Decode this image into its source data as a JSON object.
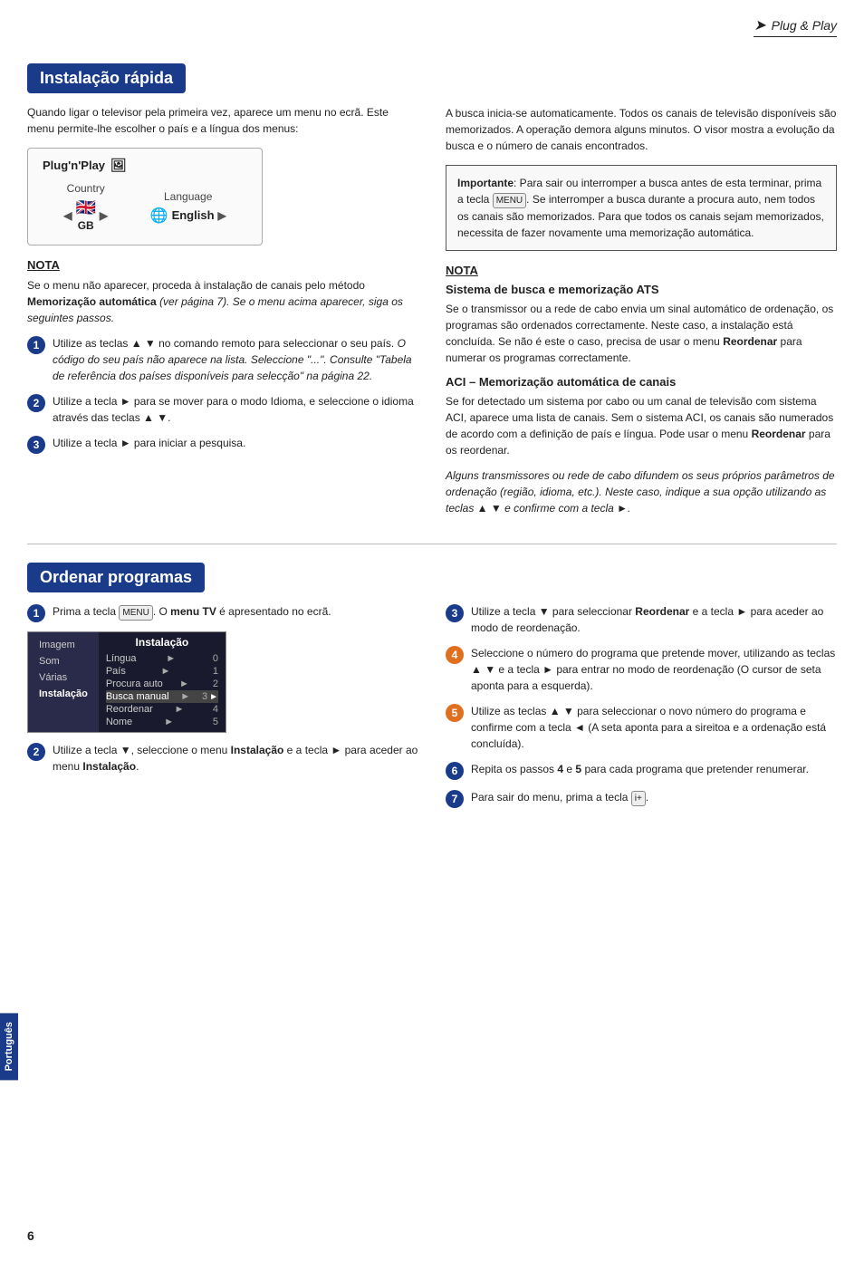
{
  "header": {
    "plug_play": "Plug & Play"
  },
  "section1": {
    "title": "Instalação rápida",
    "left": {
      "intro": "Quando ligar o televisor pela primeira vez, aparece um menu no ecrã. Este menu permite-lhe escolher o país e a língua dos menus:",
      "plugnplay_box": {
        "title": "Plug'n'Play",
        "country_label": "Country",
        "country_value": "GB",
        "language_label": "Language",
        "language_value": "English"
      },
      "nota_title": "NOTA",
      "nota_body": "Se o menu não aparecer, proceda à instalação de canais pelo método Memorização automática (ver página 7). Se o menu acima aparecer, siga os seguintes passos.",
      "steps": [
        {
          "num": "1",
          "text": "Utilize as teclas ▲ ▼ no comando remoto para seleccionar o seu país. O código do seu país não aparece na lista. Seleccione \"...\". Consulte \"Tabela de referência dos países disponíveis para selecção\" na página 22."
        },
        {
          "num": "2",
          "text": "Utilize a tecla ► para se mover para o modo Idioma, e seleccione o idioma através das teclas ▲ ▼."
        },
        {
          "num": "3",
          "text": "Utilize a tecla ► para iniciar a pesquisa."
        }
      ]
    },
    "right": {
      "intro": "A busca inicia-se automaticamente. Todos os canais de televisão disponíveis são memorizados. A operação demora alguns minutos. O visor mostra a evolução da busca e o número de canais encontrados.",
      "info_box": "Importante: Para sair ou interromper a busca antes de esta terminar, prima a tecla MENU. Se interromper a busca durante a procura auto, nem todos os canais são memorizados. Para que todos os canais sejam memorizados, necessita de fazer novamente uma memorização automática.",
      "nota_title": "NOTA",
      "subsection1_title": "Sistema de busca e memorização ATS",
      "subsection1_text": "Se o transmissor ou a rede de cabo envia um sinal automático de ordenação, os programas são ordenados correctamente. Neste caso, a instalação está concluída. Se não é este o caso, precisa de usar o menu Reordenar para numerar os programas correctamente.",
      "subsection2_title": "ACI – Memorização automática de canais",
      "subsection2_text": "Se for detectado um sistema por cabo ou um canal de televisão com sistema ACI, aparece uma lista de canais. Sem o sistema ACI, os canais são numerados de acordo com a definição de país e língua. Pode usar o menu Reordenar para os reordenar.",
      "subsection2_italic": "Alguns transmissores ou rede de cabo difundem os seus próprios parâmetros de ordenação (região, idioma, etc.). Neste caso, indique a sua opção utilizando as teclas ▲ ▼ e confirme com a tecla ►."
    }
  },
  "section2": {
    "title": "Ordenar programas",
    "left": {
      "steps": [
        {
          "num": "1",
          "text": "Prima a tecla MENU. O menu TV é apresentado no ecrã."
        },
        {
          "num": "2",
          "text": "Utilize a tecla ▼, seleccione o menu Instalação e a tecla ► para aceder ao menu Instalação."
        }
      ],
      "menu": {
        "left_items": [
          "Imagem",
          "Som",
          "Várias",
          "Instalação"
        ],
        "right_header": "Instalação",
        "right_items": [
          {
            "label": "Língua",
            "dot": "►",
            "num": "0"
          },
          {
            "label": "País",
            "dot": "►",
            "num": "1"
          },
          {
            "label": "Procura auto",
            "dot": "►",
            "num": "2"
          },
          {
            "label": "Busca manual",
            "dot": "►",
            "num": "3",
            "highlighted": true
          },
          {
            "label": "Reordenar",
            "dot": "►",
            "num": "4"
          },
          {
            "label": "Nome",
            "dot": "►",
            "num": "5"
          }
        ]
      }
    },
    "right": {
      "steps": [
        {
          "num": "3",
          "text": "Utilize a tecla ▼ para seleccionar Reordenar e a tecla ► para aceder ao modo de reordenação."
        },
        {
          "num": "4",
          "text": "Seleccione o número do programa que pretende mover, utilizando as teclas ▲ ▼ e a tecla ► para entrar no modo de reordenação (O cursor de seta aponta para a esquerda)."
        },
        {
          "num": "5",
          "text": "Utilize as teclas ▲ ▼ para seleccionar o novo número do programa e confirme com a tecla ◄ (A seta aponta para a sireitoa e a ordenação está concluída)."
        },
        {
          "num": "6",
          "text": "Repita os passos 4 e 5 para cada programa que pretender renumerar."
        },
        {
          "num": "7",
          "text": "Para sair do menu, prima a tecla [i+]."
        }
      ]
    }
  },
  "footer": {
    "page_num": "6",
    "lang_tab": "Português"
  }
}
